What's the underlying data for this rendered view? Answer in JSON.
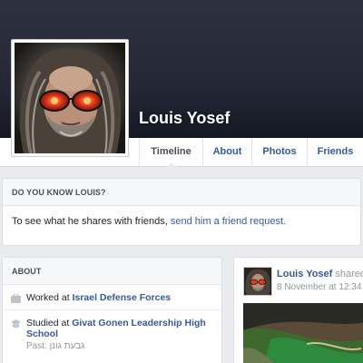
{
  "profile": {
    "name": "Louis Yosef"
  },
  "tabs": [
    {
      "label": "Timeline"
    },
    {
      "label": "About"
    },
    {
      "label": "Photos"
    },
    {
      "label": "Friends"
    }
  ],
  "know": {
    "header": "DO YOU KNOW LOUIS?",
    "text": "To see what he shares with friends, ",
    "link": "send him a friend request."
  },
  "about": {
    "header": "ABOUT",
    "work": {
      "prefix": "Worked at ",
      "value": "Israel Defense Forces",
      "icon": "briefcase-icon"
    },
    "study": {
      "prefix": "Studied at ",
      "value": "Givat Gonen Leadership High School",
      "past_label": "Past: ",
      "past_value": "גבעת גונן",
      "icon": "graduation-cap-icon"
    }
  },
  "post": {
    "author": "Louis Yosef",
    "action": " shared",
    "date": "8 November at 12:34 · "
  },
  "colors": {
    "cover": "#262a38",
    "link": "#365899",
    "page_bg": "#e9ebee"
  }
}
